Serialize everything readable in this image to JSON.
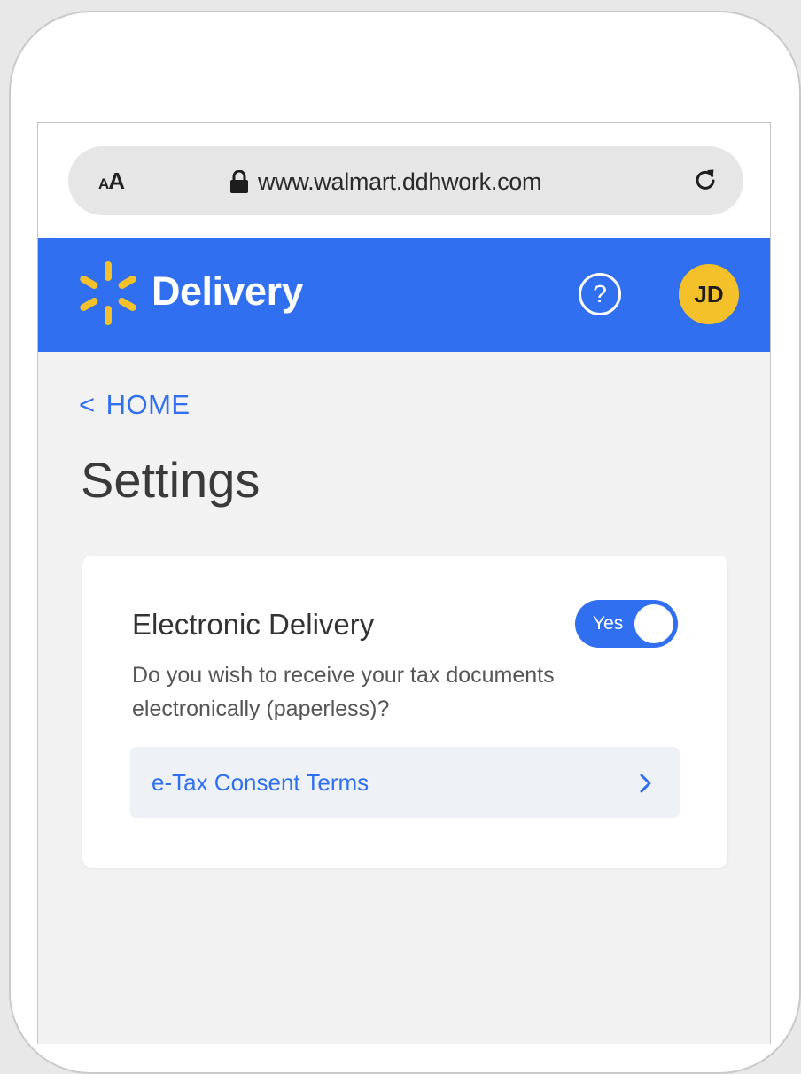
{
  "browser": {
    "text_size_label_small": "A",
    "text_size_label_large": "A",
    "url": "www.walmart.ddhwork.com",
    "icons": [
      "lock-icon",
      "reload-icon"
    ]
  },
  "header": {
    "brand_title": "Delivery",
    "help_label": "?",
    "avatar_initials": "JD",
    "colors": {
      "background": "#2f6ff0",
      "spark": "#f5c12a",
      "avatar": "#f5c12a"
    }
  },
  "nav": {
    "back_chevron": "<",
    "back_label": "HOME"
  },
  "page": {
    "title": "Settings"
  },
  "electronic_delivery": {
    "title": "Electronic Delivery",
    "toggle_label": "Yes",
    "toggle_on": true,
    "description": "Do you wish to receive your tax documents electronically (paperless)?",
    "terms_link_label": "e-Tax Consent Terms"
  }
}
